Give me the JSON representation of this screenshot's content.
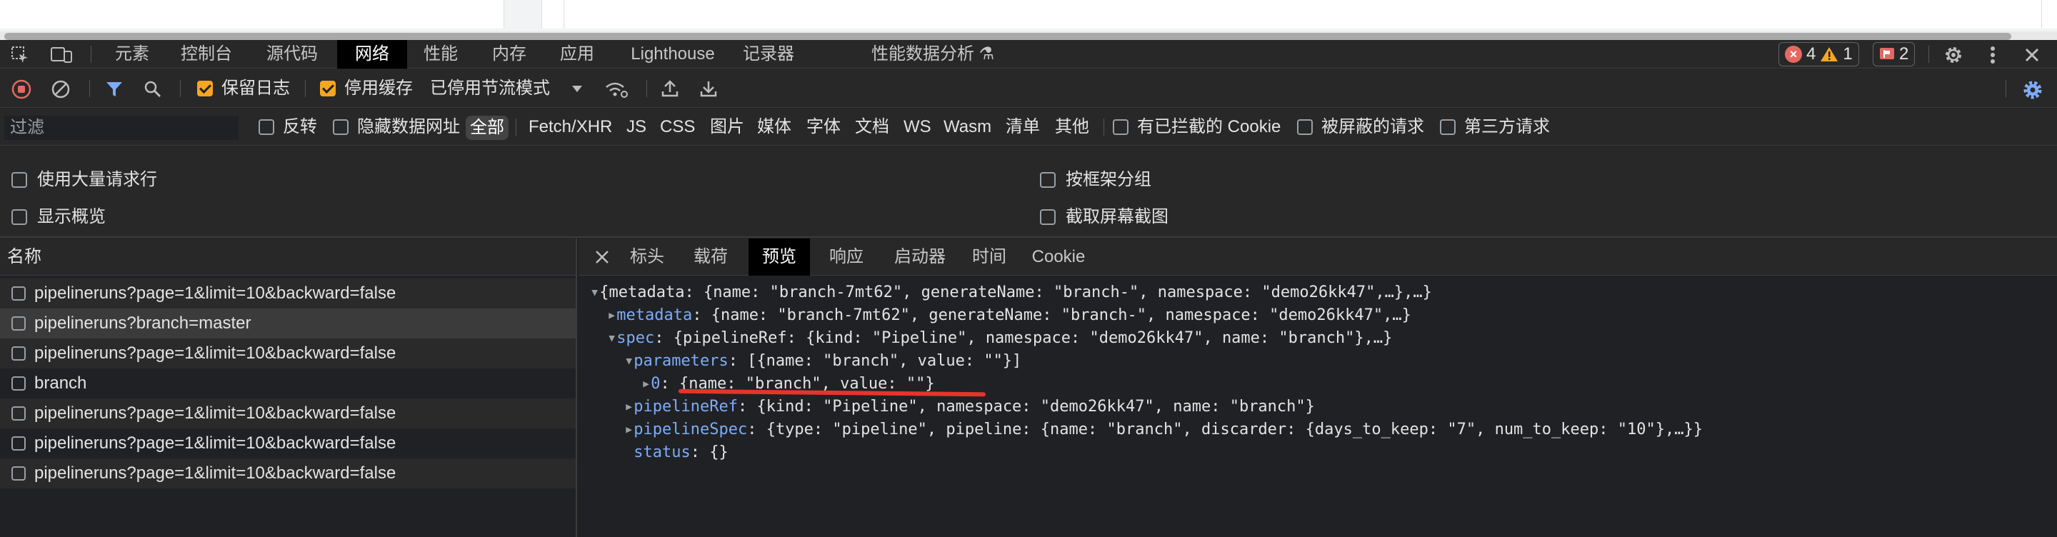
{
  "page_top": {},
  "devtools": {
    "main_tabs": [
      "元素",
      "控制台",
      "源代码",
      "网络",
      "性能",
      "内存",
      "应用",
      "Lighthouse",
      "记录器",
      "性能数据分析"
    ],
    "active_tab": "网络",
    "recorder_suffix": "⚗",
    "perf_suffix": "⚗",
    "errors_count": "4",
    "warnings_count": "1",
    "issues_count": "2",
    "icons": {
      "inspect": "inspect-element-icon",
      "device": "device-toolbar-icon",
      "settings": "gear-icon",
      "more": "more-vertical-icon",
      "close": "close-icon"
    }
  },
  "network_toolbar": {
    "preserve_log_label": "保留日志",
    "preserve_log_checked": true,
    "disable_cache_label": "停用缓存",
    "disable_cache_checked": true,
    "throttling_value": "已停用节流模式"
  },
  "filter_bar": {
    "filter_placeholder": "过滤",
    "invert_label": "反转",
    "hide_data_urls_label": "隐藏数据网址",
    "types": [
      "全部",
      "Fetch/XHR",
      "JS",
      "CSS",
      "图片",
      "媒体",
      "字体",
      "文档",
      "WS",
      "Wasm",
      "清单",
      "其他"
    ],
    "blocked_cookies_label": "有已拦截的 Cookie",
    "blocked_requests_label": "被屏蔽的请求",
    "third_party_label": "第三方请求"
  },
  "options": {
    "big_rows_label": "使用大量请求行",
    "overview_label": "显示概览",
    "group_by_frame_label": "按框架分组",
    "screenshots_label": "截取屏幕截图"
  },
  "request_list": {
    "header": "名称",
    "rows": [
      "pipelineruns?page=1&limit=10&backward=false",
      "pipelineruns?branch=master",
      "pipelineruns?page=1&limit=10&backward=false",
      "branch",
      "pipelineruns?page=1&limit=10&backward=false",
      "pipelineruns?page=1&limit=10&backward=false",
      "pipelineruns?page=1&limit=10&backward=false"
    ]
  },
  "detail": {
    "tabs": [
      "标头",
      "载荷",
      "预览",
      "响应",
      "启动器",
      "时间",
      "Cookie"
    ],
    "active_tab": "预览",
    "preview": {
      "l1_rest": "{metadata: {name: \"branch-7mt62\", generateName: \"branch-\", namespace: \"demo26kk47\",…},…}",
      "l2_key": "metadata",
      "l2_rest": ": {name: \"branch-7mt62\", generateName: \"branch-\", namespace: \"demo26kk47\",…}",
      "l3_key": "spec",
      "l3_rest": ": {pipelineRef: {kind: \"Pipeline\", namespace: \"demo26kk47\", name: \"branch\"},…}",
      "l4_key": "parameters",
      "l4_rest": ": [{name: \"branch\", value: \"\"}]",
      "l5_key": "0",
      "l5_rest": ": {name: \"branch\", value: \"\"}",
      "l6_key": "pipelineRef",
      "l6_rest": ": {kind: \"Pipeline\", namespace: \"demo26kk47\", name: \"branch\"}",
      "l7_key": "pipelineSpec",
      "l7_rest": ": {type: \"pipeline\", pipeline: {name: \"branch\", discarder: {days_to_keep: \"7\", num_to_keep: \"10\"},…}}",
      "l8_key": "status",
      "l8_rest": ": {}"
    }
  }
}
